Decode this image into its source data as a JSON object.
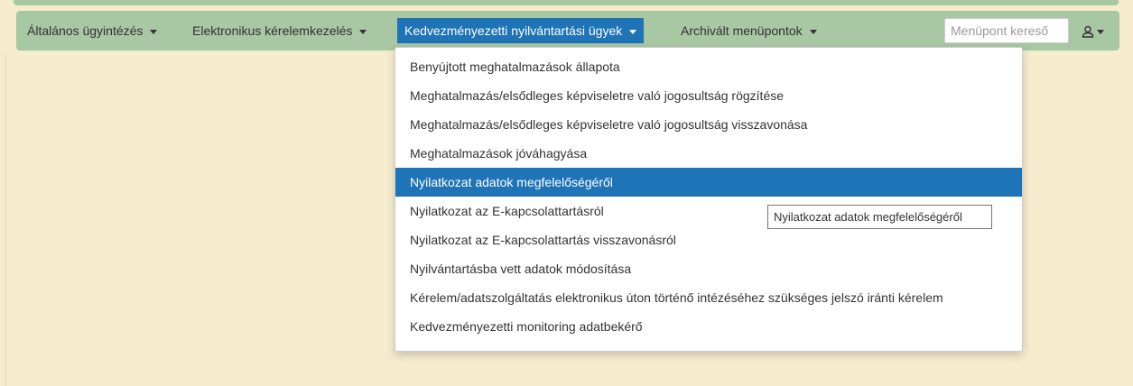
{
  "navbar": {
    "menus": [
      {
        "label": "Általános ügyintézés"
      },
      {
        "label": "Elektronikus kérelemkezelés"
      },
      {
        "label": "Kedvezményezetti nyilvántartási ügyek",
        "active": true
      },
      {
        "label": "Archivált menüpontok"
      }
    ],
    "search_placeholder": "Menüpont kereső",
    "user_icon": "user-icon"
  },
  "dropdown": {
    "items": [
      "Benyújtott meghatalmazások állapota",
      "Meghatalmazás/elsődleges képviseletre való jogosultság rögzítése",
      "Meghatalmazás/elsődleges képviseletre való jogosultság visszavonása",
      "Meghatalmazások jóváhagyása",
      "Nyilatkozat adatok megfelelőségéről",
      "Nyilatkozat az E-kapcsolattartásról",
      "Nyilatkozat az E-kapcsolattartás visszavonásról",
      "Nyilvántartásba vett adatok módosítása",
      "Kérelem/adatszolgáltatás elektronikus úton történő intézéséhez szükséges jelszó iránti kérelem",
      "Kedvezményezetti monitoring adatbekérő"
    ],
    "highlighted_index": 4
  },
  "tooltip": {
    "text": "Nyilatkozat adatok megfelelőségéről"
  },
  "colors": {
    "navbar": "#a8c7a3",
    "active": "#1f73b7",
    "page_bg": "#f5eccd"
  }
}
